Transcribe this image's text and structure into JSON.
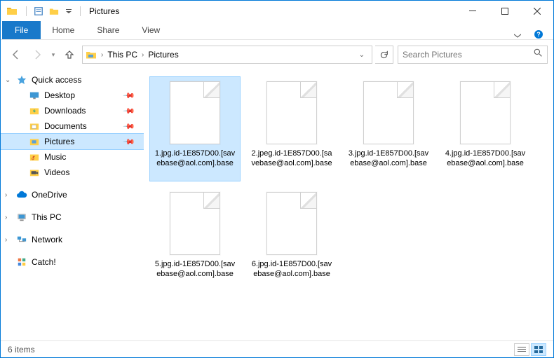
{
  "title": "Pictures",
  "tabs": {
    "file": "File",
    "home": "Home",
    "share": "Share",
    "view": "View"
  },
  "breadcrumb": {
    "root": "This PC",
    "current": "Pictures"
  },
  "search": {
    "placeholder": "Search Pictures"
  },
  "sidebar": {
    "quick_access": "Quick access",
    "items": [
      {
        "label": "Desktop"
      },
      {
        "label": "Downloads"
      },
      {
        "label": "Documents"
      },
      {
        "label": "Pictures"
      },
      {
        "label": "Music"
      },
      {
        "label": "Videos"
      }
    ],
    "onedrive": "OneDrive",
    "thispc": "This PC",
    "network": "Network",
    "catch": "Catch!"
  },
  "files": [
    {
      "name": "1.jpg.id-1E857D00.[savebase@aol.com].base"
    },
    {
      "name": "2.jpeg.id-1E857D00.[savebase@aol.com].base"
    },
    {
      "name": "3.jpg.id-1E857D00.[savebase@aol.com].base"
    },
    {
      "name": "4.jpg.id-1E857D00.[savebase@aol.com].base"
    },
    {
      "name": "5.jpg.id-1E857D00.[savebase@aol.com].base"
    },
    {
      "name": "6.jpg.id-1E857D00.[savebase@aol.com].base"
    }
  ],
  "status": {
    "count": "6 items"
  }
}
